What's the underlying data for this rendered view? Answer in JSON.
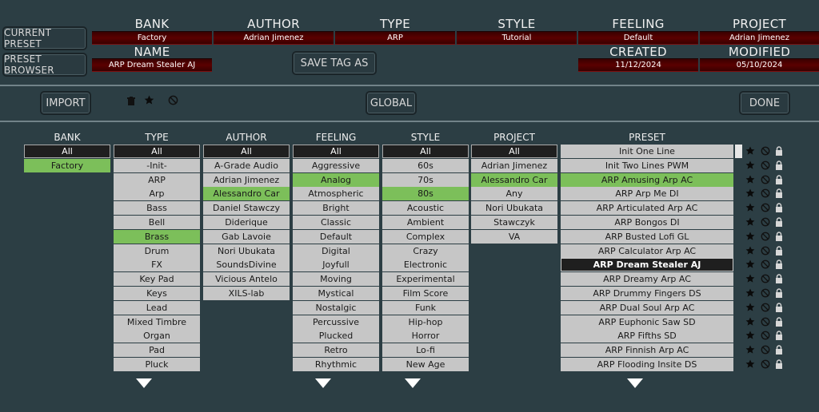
{
  "side": {
    "current_preset": "CURRENT PRESET",
    "preset_browser": "PRESET BROWSER"
  },
  "header": {
    "bank_label": "BANK",
    "bank_value": "Factory",
    "author_label": "AUTHOR",
    "author_value": "Adrian Jimenez",
    "type_label": "TYPE",
    "type_value": "ARP",
    "style_label": "STYLE",
    "style_value": "Tutorial",
    "feeling_label": "FEELING",
    "feeling_value": "Default",
    "project_label": "PROJECT",
    "project_value": "Adrian Jimenez",
    "name_label": "NAME",
    "name_value": "ARP Dream Stealer AJ",
    "created_label": "CREATED",
    "created_value": "11/12/2024",
    "modified_label": "MODIFIED",
    "modified_value": "05/10/2024",
    "save_tag": "SAVE TAG AS"
  },
  "toolbar": {
    "import": "IMPORT",
    "global": "GLOBAL",
    "done": "DONE"
  },
  "columns": {
    "bank": {
      "title": "BANK",
      "all": "All",
      "items": [
        "Factory"
      ],
      "selected": 0
    },
    "type": {
      "title": "TYPE",
      "all": "All",
      "items": [
        "-Init-",
        "ARP",
        "Arp",
        "Bass",
        "Bell",
        "Brass",
        "Drum",
        "FX",
        "Key Pad",
        "Keys",
        "Lead",
        "Mixed Timbre",
        "Organ",
        "Pad",
        "Pluck"
      ],
      "selected": 5
    },
    "author": {
      "title": "AUTHOR",
      "all": "All",
      "items": [
        "A-Grade Audio",
        "Adrian Jimenez",
        "Alessandro Car",
        "Daniel Stawczy",
        "Diderique",
        "Gab Lavoie",
        "Nori Ubukata",
        "SoundsDivine",
        "Vicious Antelo",
        "XILS-lab"
      ],
      "selected": 2
    },
    "feeling": {
      "title": "FEELING",
      "all": "All",
      "items": [
        "Aggressive",
        "Analog",
        "Atmospheric",
        "Bright",
        "Classic",
        "Default",
        "Digital",
        "Joyfull",
        "Moving",
        "Mystical",
        "Nostalgic",
        "Percussive",
        "Plucked",
        "Retro",
        "Rhythmic"
      ],
      "selected": 1
    },
    "style": {
      "title": "STYLE",
      "all": "All",
      "items": [
        "60s",
        "70s",
        "80s",
        "Acoustic",
        "Ambient",
        "Complex",
        "Crazy",
        "Electronic",
        "Experimental",
        "Film Score",
        "Funk",
        "Hip-hop",
        "Horror",
        "Lo-fi",
        "New Age"
      ],
      "selected": 2
    },
    "project": {
      "title": "PROJECT",
      "all": "All",
      "items": [
        "Adrian Jimenez",
        "Alessandro Car",
        "Any",
        "Nori Ubukata",
        "Stawczyk",
        "VA"
      ],
      "selected": 1
    },
    "preset": {
      "title": "PRESET",
      "items": [
        "Init One Line",
        "Init Two Lines PWM",
        "ARP Amusing Arp AC",
        "ARP Arp Me DI",
        "ARP Articulated Arp AC",
        "ARP Bongos DI",
        "ARP Busted Lofi GL",
        "ARP Calculator Arp AC",
        "ARP Dream Stealer AJ",
        "ARP Dreamy Arp AC",
        "ARP Drummy Fingers DS",
        "ARP Dual Soul Arp AC",
        "ARP Euphonic Saw SD",
        "ARP Fifths SD",
        "ARP Finnish Arp AC",
        "ARP Flooding Insite DS"
      ],
      "selected": 2,
      "current": 8
    }
  },
  "icons": [
    "trash-icon",
    "star-icon",
    "no-icon",
    "lock-icon",
    "down-arrow-icon"
  ],
  "colors": {
    "background": "#2c3e44",
    "selected": "#7cbf5a",
    "field": "#5a0000",
    "cell": "#c6c6c6"
  }
}
